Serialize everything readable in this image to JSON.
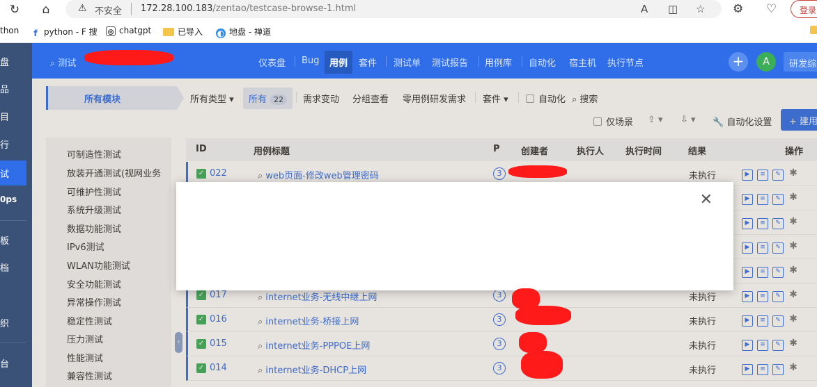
{
  "browser": {
    "insecure_label": "不安全",
    "url_host": "172.28.100.183",
    "url_path": "/zentao/testcase-browse-1.html",
    "login_label": "登录",
    "bookmarks": [
      {
        "label": "thon"
      },
      {
        "label": "python - F 搜"
      },
      {
        "label": "chatgpt"
      },
      {
        "label": "已导入"
      },
      {
        "label": "地盘 - 禅道"
      }
    ]
  },
  "leftnav": {
    "items": [
      "盘",
      "品",
      "目",
      "行",
      "试",
      "0ps",
      "板",
      "档",
      "织",
      "台"
    ],
    "active_index": 4
  },
  "topbar": {
    "search_label": "测试",
    "nav": [
      "仪表盘",
      "Bug",
      "用例",
      "套件",
      "测试单",
      "测试报告",
      "用例库",
      "自动化",
      "宿主机",
      "执行节点"
    ],
    "active_nav": "用例",
    "avatar_letter": "A",
    "research_label": "研发综"
  },
  "module_panel": {
    "tab_label": "所有模块",
    "items": [
      "可制造性测试",
      "放装开通测试(视网业务",
      "可维护性测试",
      "系统升级测试",
      "数据功能测试",
      "IPv6测试",
      "WLAN功能测试",
      "安全功能测试",
      "异常操作测试",
      "稳定性测试",
      "压力测试",
      "性能测试",
      "兼容性测试"
    ]
  },
  "filters": {
    "all_types": "所有类型",
    "all": "所有",
    "all_count": "22",
    "req_change": "需求变动",
    "group_view": "分组查看",
    "zero_case": "零用例研发需求",
    "suite": "套件",
    "automation": "自动化",
    "search": "搜索",
    "scene_only": "仅场景",
    "auto_settings": "自动化设置",
    "build": "建用"
  },
  "table": {
    "headers": {
      "id": "ID",
      "title": "用例标题",
      "p": "P",
      "creator": "创建者",
      "executor": "执行人",
      "exec_time": "执行时间",
      "result": "结果",
      "actions": "操作"
    },
    "rows": [
      {
        "id": "022",
        "title": "web页面-修改web管理密码",
        "p": "3",
        "result": "未执行"
      },
      {
        "id": "017",
        "title": "internet业务-无线中继上网",
        "p": "3",
        "result": "未执行"
      },
      {
        "id": "016",
        "title": "internet业务-桥接上网",
        "p": "3",
        "result": "未执行"
      },
      {
        "id": "015",
        "title": "internet业务-PPPOE上网",
        "p": "3",
        "result": "未执行"
      },
      {
        "id": "014",
        "title": "internet业务-DHCP上网",
        "p": "3",
        "result": "未执行"
      }
    ]
  },
  "dialog": {
    "close_symbol": "✕"
  },
  "colors": {
    "primary": "#2f6ee8",
    "sidebar": "#3a5178",
    "success": "#3cae5a"
  }
}
